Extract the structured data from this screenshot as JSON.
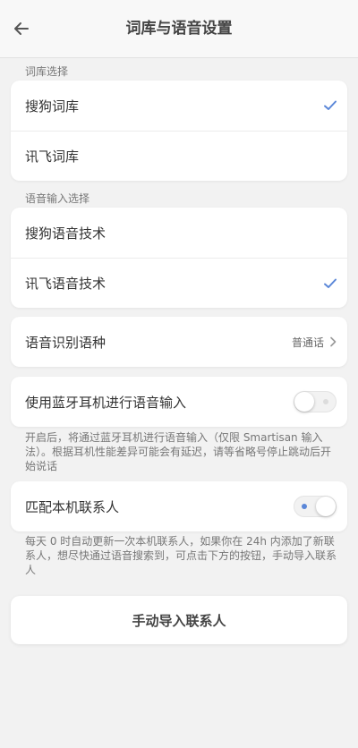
{
  "header": {
    "title": "词库与语音设置"
  },
  "dictionary": {
    "section_label": "词库选择",
    "items": [
      {
        "label": "搜狗词库",
        "selected": true
      },
      {
        "label": "讯飞词库",
        "selected": false
      }
    ]
  },
  "voice_input": {
    "section_label": "语音输入选择",
    "items": [
      {
        "label": "搜狗语音技术",
        "selected": false
      },
      {
        "label": "讯飞语音技术",
        "selected": true
      }
    ]
  },
  "language": {
    "label": "语音识别语种",
    "value": "普通话"
  },
  "bluetooth": {
    "label": "使用蓝牙耳机进行语音输入",
    "enabled": false,
    "hint": "开启后，将通过蓝牙耳机进行语音输入（仅限 Smartisan 输入法）。根据耳机性能差异可能会有延迟，请等省略号停止跳动后开始说话"
  },
  "contacts": {
    "label": "匹配本机联系人",
    "enabled": true,
    "hint": "每天 0 时自动更新一次本机联系人，如果你在 24h 内添加了新联系人，想尽快通过语音搜索到，可点击下方的按钮，手动导入联系人"
  },
  "import_button": {
    "label": "手动导入联系人"
  },
  "colors": {
    "accent": "#5b87d8",
    "toggle_dot_off": "#dcdcdc"
  }
}
